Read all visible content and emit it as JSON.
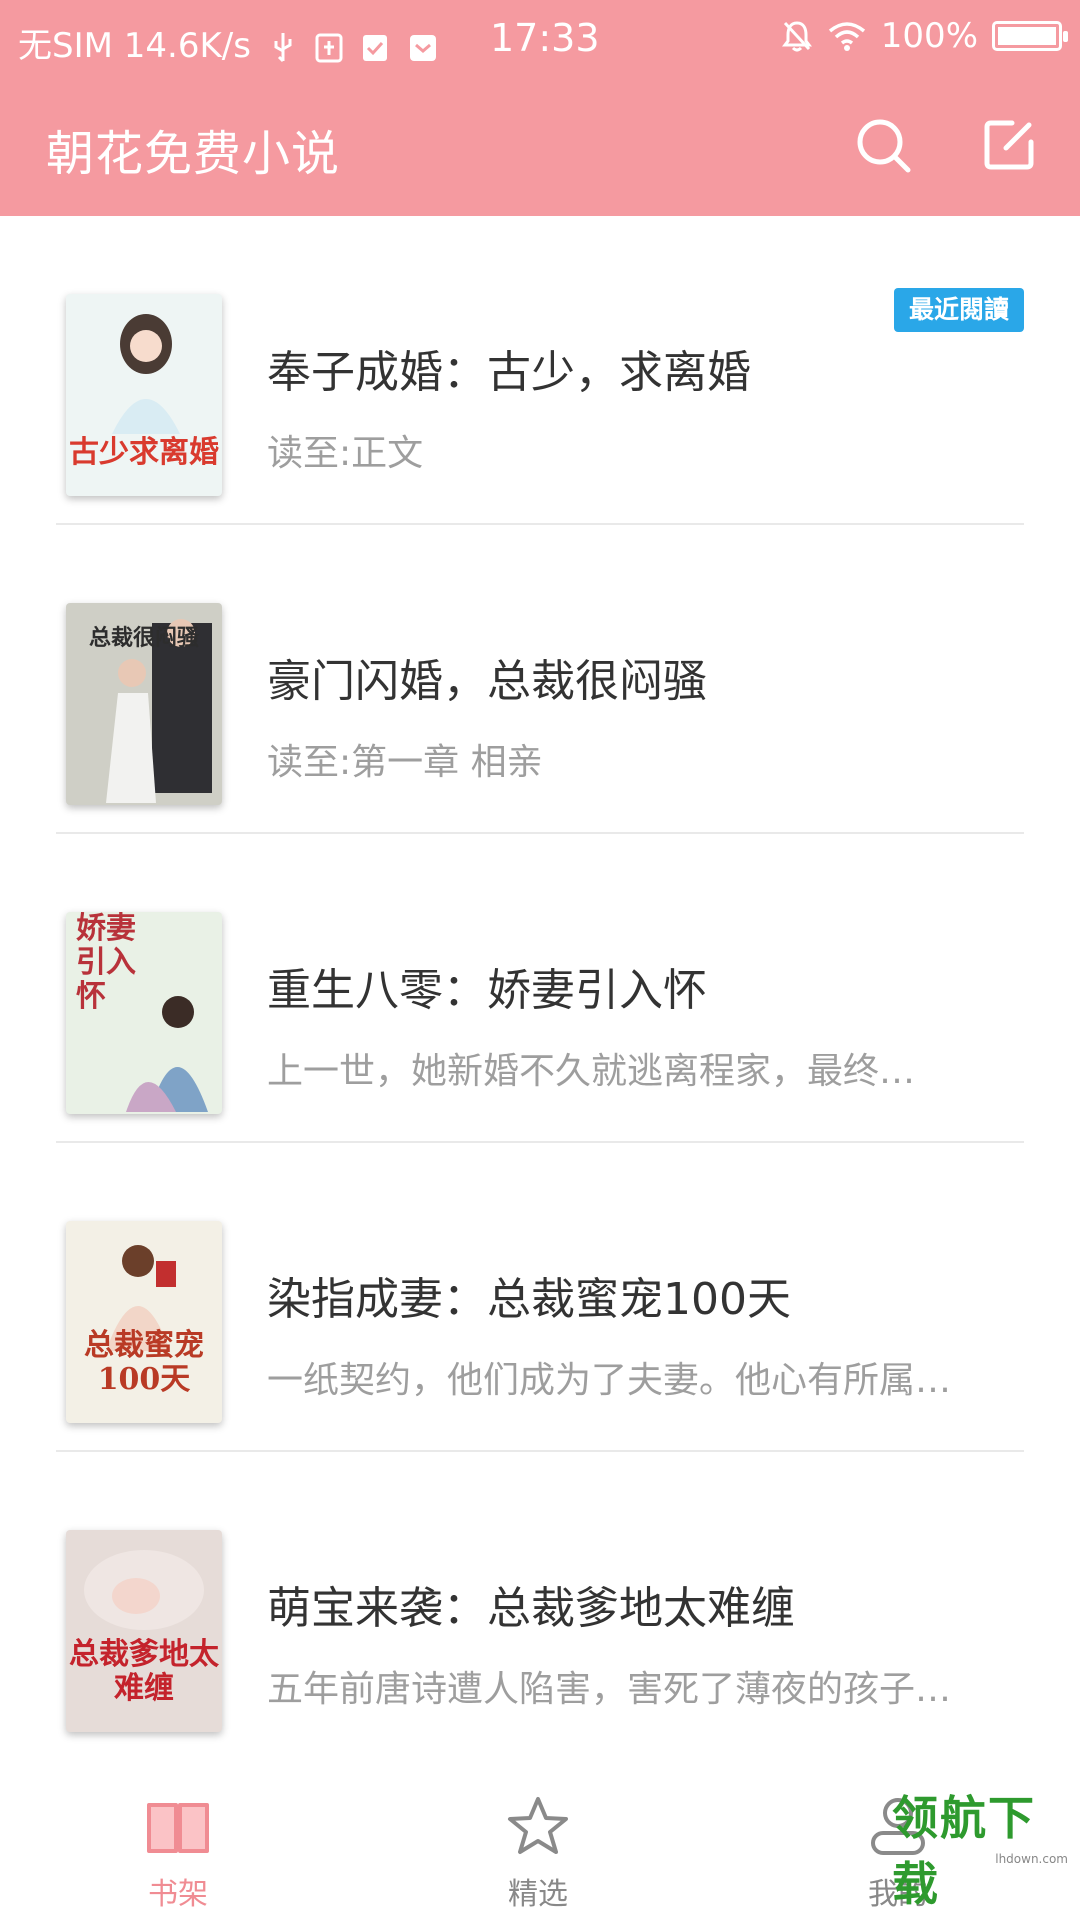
{
  "status_bar": {
    "carrier": "无SIM",
    "speed": "14.6K/s",
    "time": "17:33",
    "battery": "100%"
  },
  "app_bar": {
    "title": "朝花免费小说",
    "search_icon": "search-icon",
    "edit_icon": "edit-icon"
  },
  "books": [
    {
      "title": "奉子成婚：古少，求离婚",
      "subtitle": "读至:正文",
      "badge": "最近閱讀",
      "cover": {
        "text": "古少求离婚",
        "bg": "#eef5f4",
        "color": "#d93a2e"
      }
    },
    {
      "title": "豪门闪婚，总裁很闷骚",
      "subtitle": "读至:第一章 相亲",
      "cover": {
        "text": "总裁很闷骚",
        "bg": "#cfcfc6",
        "color": "#2d2d2d"
      }
    },
    {
      "title": "重生八零：娇妻引入怀",
      "subtitle": "  上一世，她新婚不久就逃离程家，最终…",
      "cover": {
        "text": "娇妻引入怀",
        "bg": "#e9f1e6",
        "color": "#b8323a"
      }
    },
    {
      "title": "染指成妻：总裁蜜宠100天",
      "subtitle": "一纸契约，他们成为了夫妻。他心有所属…",
      "cover": {
        "text": "总裁蜜宠100天",
        "bg": "#f3f0e6",
        "color": "#b93a25"
      }
    },
    {
      "title": "萌宝来袭：总裁爹地太难缠",
      "subtitle": "五年前唐诗遭人陷害，害死了薄夜的孩子…",
      "cover": {
        "text": "总裁爹地太难缠",
        "bg": "#e6dcd8",
        "color": "#c4232c"
      }
    }
  ],
  "tabs": [
    {
      "label": "书架",
      "icon": "book-icon",
      "active": true
    },
    {
      "label": "精选",
      "icon": "star-icon",
      "active": false
    },
    {
      "label": "我的",
      "icon": "user-icon",
      "active": false
    }
  ],
  "watermark": {
    "text": "领航下载",
    "url": "lhdown.com"
  },
  "colors": {
    "accent": "#f59aa0",
    "badge": "#2aa7e8",
    "title_text": "#333333",
    "sub_text": "#9e9e9e",
    "tab_active": "#f08c93",
    "tab_inactive": "#888888"
  }
}
